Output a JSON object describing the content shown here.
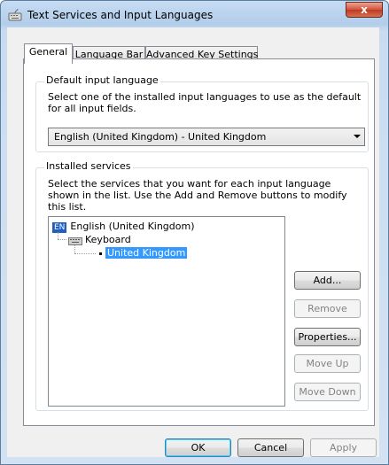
{
  "window": {
    "title": "Text Services and Input Languages",
    "close_label": "x"
  },
  "tabs": [
    {
      "label": "General",
      "active": true
    },
    {
      "label": "Language Bar",
      "active": false
    },
    {
      "label": "Advanced Key Settings",
      "active": false
    }
  ],
  "default_input": {
    "group_label": "Default input language",
    "description": "Select one of the installed input languages to use as the default for all input fields.",
    "selected": "English (United Kingdom) - United Kingdom"
  },
  "installed_services": {
    "group_label": "Installed services",
    "description": "Select the services that you want for each input language shown in the list. Use the Add and Remove buttons to modify this list.",
    "tree": {
      "language_badge": "EN",
      "language": "English (United Kingdom)",
      "category": "Keyboard",
      "layout": "United Kingdom"
    },
    "buttons": {
      "add": "Add...",
      "remove": "Remove",
      "properties": "Properties...",
      "move_up": "Move Up",
      "move_down": "Move Down"
    }
  },
  "footer": {
    "ok": "OK",
    "cancel": "Cancel",
    "apply": "Apply"
  }
}
